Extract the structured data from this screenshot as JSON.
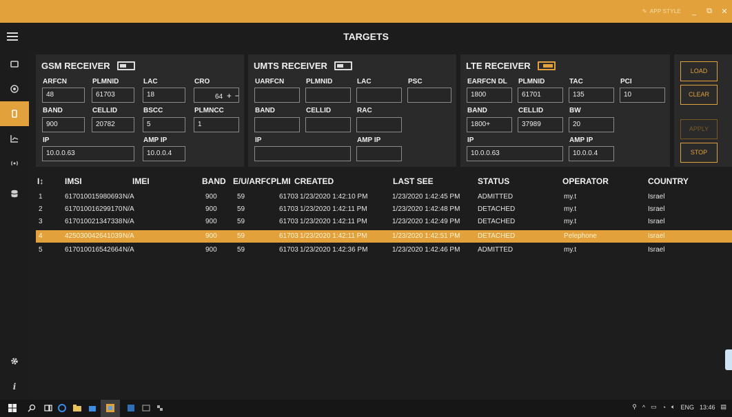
{
  "titlebar": {
    "app_style_label": "APP STYLE",
    "minimize": "_",
    "restore": "⧉",
    "close": "✕",
    "accent": "#e2a13a"
  },
  "header": {
    "title": "TARGETS"
  },
  "sidebar": {
    "items": [
      {
        "name": "window-icon"
      },
      {
        "name": "target-icon"
      },
      {
        "name": "phone-icon",
        "active": true
      },
      {
        "name": "chart-icon"
      },
      {
        "name": "antenna-icon"
      },
      {
        "name": "database-icon"
      }
    ],
    "bottom": [
      {
        "name": "settings-icon"
      },
      {
        "name": "info-icon",
        "glyph": "i"
      }
    ]
  },
  "gsm": {
    "title": "GSM RECEIVER",
    "toggle_on": false,
    "arfcn_label": "ARFCN",
    "arfcn": "48",
    "plmnid_label": "PLMNID",
    "plmnid": "61703",
    "lac_label": "LAC",
    "lac": "18",
    "cro_label": "CRO",
    "cro": "64",
    "band_label": "BAND",
    "band": "900",
    "cellid_label": "CELLID",
    "cellid": "20782",
    "bscc_label": "BSCC",
    "bscc": "5",
    "plmncc_label": "PLMNCC",
    "plmncc": "1",
    "ip_label": "IP",
    "ip": "10.0.0.63",
    "ampip_label": "AMP IP",
    "ampip": "10.0.0.4"
  },
  "umts": {
    "title": "UMTS RECEIVER",
    "toggle_on": false,
    "uarfcn_label": "UARFCN",
    "uarfcn": "",
    "plmnid_label": "PLMNID",
    "plmnid": "",
    "lac_label": "LAC",
    "lac": "",
    "psc_label": "PSC",
    "psc": "",
    "band_label": "BAND",
    "band": "",
    "cellid_label": "CELLID",
    "cellid": "",
    "rac_label": "RAC",
    "rac": "",
    "ip_label": "IP",
    "ip": "",
    "ampip_label": "AMP IP",
    "ampip": ""
  },
  "lte": {
    "title": "LTE RECEIVER",
    "toggle_on": true,
    "earfcn_label": "EARFCN DL",
    "earfcn": "1800",
    "plmnid_label": "PLMNID",
    "plmnid": "61701",
    "tac_label": "TAC",
    "tac": "135",
    "pci_label": "PCI",
    "pci": "10",
    "band_label": "BAND",
    "band": "1800+",
    "cellid_label": "CELLID",
    "cellid": "37989",
    "bw_label": "BW",
    "bw": "20",
    "ip_label": "IP",
    "ip": "10.0.0.63",
    "ampip_label": "AMP IP",
    "ampip": "10.0.0.4"
  },
  "actions": {
    "load": "LOAD",
    "clear": "CLEAR",
    "apply": "APPLY",
    "stop": "STOP"
  },
  "table": {
    "headers": {
      "sort": "I↕",
      "imsi": "IMSI",
      "imei": "IMEI",
      "band": "BAND",
      "euarfc": "E/U/ARFC",
      "plmn": "PLMI",
      "created": "CREATED",
      "last_seen": "LAST SEE",
      "status": "STATUS",
      "operator": "OPERATOR",
      "country": "COUNTRY"
    },
    "rows": [
      {
        "n": "1",
        "imsi": "617010015980693",
        "imei": "N/A",
        "band": "900",
        "arfcn": "59",
        "plmn": "61703",
        "created": "1/23/2020 1:42:10 PM",
        "last": "1/23/2020 1:42:45 PM",
        "status": "ADMITTED",
        "operator": "my.t",
        "country": "Israel"
      },
      {
        "n": "2",
        "imsi": "617010016299170",
        "imei": "N/A",
        "band": "900",
        "arfcn": "59",
        "plmn": "61703",
        "created": "1/23/2020 1:42:11 PM",
        "last": "1/23/2020 1:42:48 PM",
        "status": "DETACHED",
        "operator": "my.t",
        "country": "Israel"
      },
      {
        "n": "3",
        "imsi": "617010021347338",
        "imei": "N/A",
        "band": "900",
        "arfcn": "59",
        "plmn": "61703",
        "created": "1/23/2020 1:42:11 PM",
        "last": "1/23/2020 1:42:49 PM",
        "status": "DETACHED",
        "operator": "my.t",
        "country": "Israel"
      },
      {
        "n": "4",
        "imsi": "425030042641039",
        "imei": "N/A",
        "band": "900",
        "arfcn": "59",
        "plmn": "61703",
        "created": "1/23/2020 1:42:11 PM",
        "last": "1/23/2020 1:42:51 PM",
        "status": "DETACHED",
        "operator": "Pelephone",
        "country": "Israel",
        "selected": true
      },
      {
        "n": "5",
        "imsi": "617010016542664",
        "imei": "N/A",
        "band": "900",
        "arfcn": "59",
        "plmn": "61703",
        "created": "1/23/2020 1:42:36 PM",
        "last": "1/23/2020 1:42:46 PM",
        "status": "ADMITTED",
        "operator": "my.t",
        "country": "Israel"
      }
    ]
  },
  "taskbar": {
    "lang": "ENG",
    "time": "13:46"
  }
}
